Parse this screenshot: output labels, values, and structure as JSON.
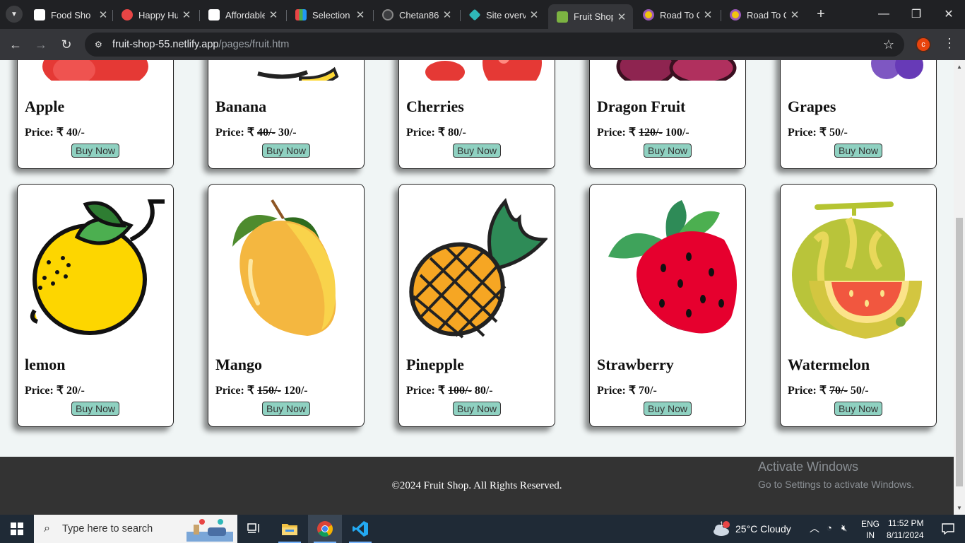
{
  "browser": {
    "tabs": [
      {
        "title": "Food Shop",
        "favicon": "openai-icon",
        "color": "#ffffff"
      },
      {
        "title": "Happy Hub",
        "favicon": "happy-face-icon",
        "color": "#e84545"
      },
      {
        "title": "Affordable",
        "favicon": "openai-icon",
        "color": "#ffffff"
      },
      {
        "title": "Selection",
        "favicon": "zoho-icon",
        "color": "#e9a23b"
      },
      {
        "title": "Chetan86",
        "favicon": "github-icon",
        "color": "#24292e"
      },
      {
        "title": "Site overv",
        "favicon": "netlify-icon",
        "color": "#2fb8b8"
      },
      {
        "title": "Fruit Shop",
        "favicon": "fruit-icon",
        "color": "#7cb342"
      },
      {
        "title": "Road To C",
        "favicon": "hexagon-icon",
        "color": "#9b59b6"
      },
      {
        "title": "Road To C",
        "favicon": "hexagon-icon",
        "color": "#9b59b6"
      }
    ],
    "active_tab_index": 6,
    "url_host": "fruit-shop-55.netlify.app",
    "url_path": "/pages/fruit.htm",
    "profile_initial": "c"
  },
  "products": {
    "top_row": [
      {
        "name": "Apple",
        "price_prefix": "Price: ₹ ",
        "old_price": "",
        "price": "40/-"
      },
      {
        "name": "Banana",
        "price_prefix": "Price: ₹ ",
        "old_price": "40/-",
        "price": "30/-"
      },
      {
        "name": "Cherries",
        "price_prefix": "Price: ₹ ",
        "old_price": "",
        "price": "80/-"
      },
      {
        "name": "Dragon Fruit",
        "price_prefix": "Price: ₹ ",
        "old_price": "120/-",
        "price": "100/-"
      },
      {
        "name": "Grapes",
        "price_prefix": "Price: ₹ ",
        "old_price": "",
        "price": "50/-"
      }
    ],
    "bottom_row": [
      {
        "name": "lemon",
        "price_prefix": "Price: ₹ ",
        "old_price": "",
        "price": "20/-"
      },
      {
        "name": "Mango",
        "price_prefix": "Price: ₹ ",
        "old_price": "150/-",
        "price": "120/-"
      },
      {
        "name": "Pinepple",
        "price_prefix": "Price: ₹ ",
        "old_price": "100/-",
        "price": "80/-"
      },
      {
        "name": "Strawberry",
        "price_prefix": "Price: ₹ ",
        "old_price": "",
        "price": "70/-"
      },
      {
        "name": "Watermelon",
        "price_prefix": "Price: ₹ ",
        "old_price": "70/-",
        "price": "50/-"
      }
    ],
    "buy_label": "Buy Now"
  },
  "footer": {
    "copyright": "©2024 Fruit Shop. All Rights Reserved."
  },
  "watermark": {
    "line1": "Activate Windows",
    "line2": "Go to Settings to activate Windows."
  },
  "taskbar": {
    "search_placeholder": "Type here to search",
    "weather": "25°C  Cloudy",
    "weather_badge": "1",
    "lang_line1": "ENG",
    "lang_line2": "IN",
    "time": "11:52 PM",
    "date": "8/11/2024"
  }
}
